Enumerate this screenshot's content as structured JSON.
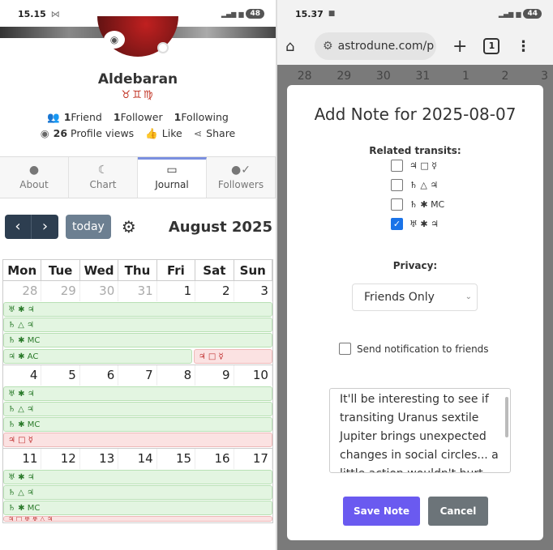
{
  "left": {
    "status": {
      "time": "15.15",
      "mail_icon": "⋈",
      "battery": "48"
    },
    "profile": {
      "name": "Aldebaran",
      "signs": "♉♊♍",
      "friends_count": "1",
      "friends_label": "Friend",
      "followers_count": "1",
      "followers_label": "Follower",
      "following_count": "1",
      "following_label": "Following",
      "views_count": "26",
      "views_label": "Profile views",
      "like_label": "Like",
      "share_label": "Share"
    },
    "tabs": [
      {
        "label": "About",
        "icon": "user-icon"
      },
      {
        "label": "Chart",
        "icon": "moon-icon"
      },
      {
        "label": "Journal",
        "icon": "calendar-icon"
      },
      {
        "label": "Followers",
        "icon": "user-check-icon"
      }
    ],
    "calendar": {
      "today_label": "today",
      "month": "August 2025",
      "dow": [
        "Mon",
        "Tue",
        "Wed",
        "Thu",
        "Fri",
        "Sat",
        "Sun"
      ],
      "weeks": [
        {
          "days": [
            "28",
            "29",
            "30",
            "31",
            "1",
            "2",
            "3"
          ],
          "events": [
            "♅ ✱ ♃",
            "♄ △ ♃",
            "♄ ✱ MC"
          ],
          "split": {
            "left": "♃ ✱ AC",
            "right": "♃ □ ☿"
          }
        },
        {
          "days": [
            "4",
            "5",
            "6",
            "7",
            "8",
            "9",
            "10"
          ],
          "events": [
            "♅ ✱ ♃",
            "♄ △ ♃",
            "♄ ✱ MC"
          ],
          "red": "♃ □ ☿"
        },
        {
          "days": [
            "11",
            "12",
            "13",
            "14",
            "15",
            "16",
            "17"
          ],
          "events": [
            "♅ ✱ ♃",
            "♄ △ ♃",
            "♄ ✱ MC"
          ],
          "partial": "♃ □ ♅ ♅ △ ♃"
        }
      ]
    }
  },
  "right": {
    "status": {
      "time": "15.37",
      "battery": "44"
    },
    "browser": {
      "url": "astrodune.com/p",
      "tab_count": "1"
    },
    "bg_days": [
      "28",
      "29",
      "30",
      "31",
      "1",
      "2",
      "3"
    ],
    "modal": {
      "title": "Add Note for 2025-08-07",
      "related_label": "Related transits:",
      "transits": [
        {
          "label": "♃ □ ☿",
          "checked": false
        },
        {
          "label": "♄ △ ♃",
          "checked": false
        },
        {
          "label": "♄ ✱ MC",
          "checked": false
        },
        {
          "label": "♅ ✱ ♃",
          "checked": true
        }
      ],
      "privacy_label": "Privacy:",
      "privacy_value": "Friends Only",
      "notify_label": "Send notification to friends",
      "note_text": "It'll be interesting to see if transiting Uranus sextile Jupiter brings unexpected changes in social circles... a little action wouldn't hurt.",
      "save_label": "Save Note",
      "cancel_label": "Cancel"
    }
  }
}
